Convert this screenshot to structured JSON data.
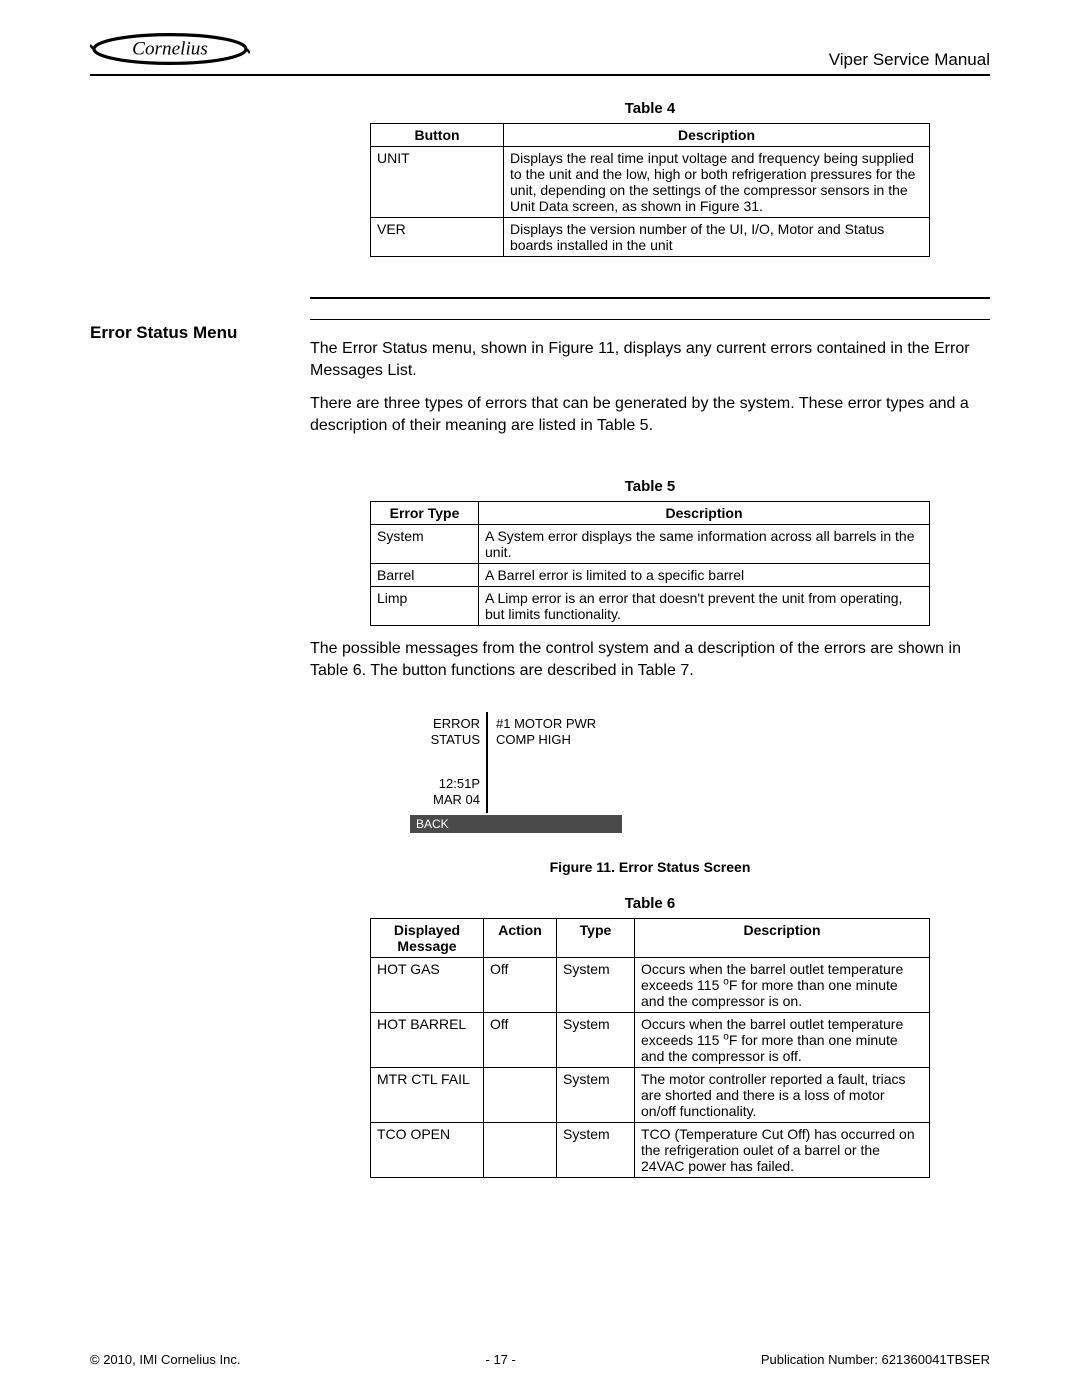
{
  "header": {
    "logo_text": "Cornelius",
    "manual_title": "Viper Service Manual"
  },
  "table4": {
    "caption": "Table 4",
    "col1": "Button",
    "col2": "Description",
    "rows": [
      {
        "button": "UNIT",
        "desc": "Displays the real time input voltage and frequency being supplied to the unit and the low, high or both refrigeration pressures for the unit, depending on the settings of the compressor sensors in the Unit Data screen, as shown in Figure 31."
      },
      {
        "button": "VER",
        "desc": "Displays the version number of the UI, I/O, Motor and Status boards installed in the unit"
      }
    ]
  },
  "section": {
    "heading": "Error Status Menu",
    "para1": "The Error Status menu, shown in Figure 11, displays any current errors contained in the Error Messages List.",
    "para2": "There are three types of errors that can be generated by the system. These error types and a description of their meaning are listed in Table 5."
  },
  "table5": {
    "caption": "Table 5",
    "col1": "Error Type",
    "col2": "Description",
    "rows": [
      {
        "type": "System",
        "desc": "A System error displays the same information across all barrels in the unit."
      },
      {
        "type": "Barrel",
        "desc": "A Barrel error is limited to a specific barrel"
      },
      {
        "type": "Limp",
        "desc": "A Limp error is an error that doesn't prevent the unit from operating, but limits functionality."
      }
    ]
  },
  "para_after_t5": "The possible messages from the control system and a description of the errors are shown in Table 6. The button functions are described in Table 7.",
  "figure11": {
    "caption": "Figure 11. Error Status Screen",
    "left_line1": "ERROR",
    "left_line2": "STATUS",
    "time": "12:51P",
    "date": "MAR 04",
    "right_line1": "#1 MOTOR PWR",
    "right_line2": "COMP HIGH",
    "bar": "BACK"
  },
  "table6": {
    "caption": "Table 6",
    "col1": "Displayed Message",
    "col2": "Action",
    "col3": "Type",
    "col4": "Description",
    "rows": [
      {
        "msg": "HOT GAS",
        "action": "Off",
        "type": "System",
        "desc_pre": "Occurs when the barrel outlet temperature exceeds 115 ",
        "desc_unit": "o",
        "desc_post": "F for more than one minute and the compressor is on."
      },
      {
        "msg": "HOT BARREL",
        "action": "Off",
        "type": "System",
        "desc_pre": "Occurs when the barrel outlet temperature exceeds 115 ",
        "desc_unit": "o",
        "desc_post": "F for more than one minute and the compressor is off."
      },
      {
        "msg": "MTR CTL FAIL",
        "action": "",
        "type": "System",
        "desc": "The motor controller reported a fault, triacs are shorted and there is a loss of motor on/off functionality."
      },
      {
        "msg": "TCO OPEN",
        "action": "",
        "type": "System",
        "desc": "TCO (Temperature Cut Off) has occurred on the refrigeration oulet of a barrel or the 24VAC power has failed."
      }
    ]
  },
  "footer": {
    "left": "© 2010, IMI Cornelius Inc.",
    "center": "- 17 -",
    "right": "Publication Number: 621360041TBSER"
  }
}
